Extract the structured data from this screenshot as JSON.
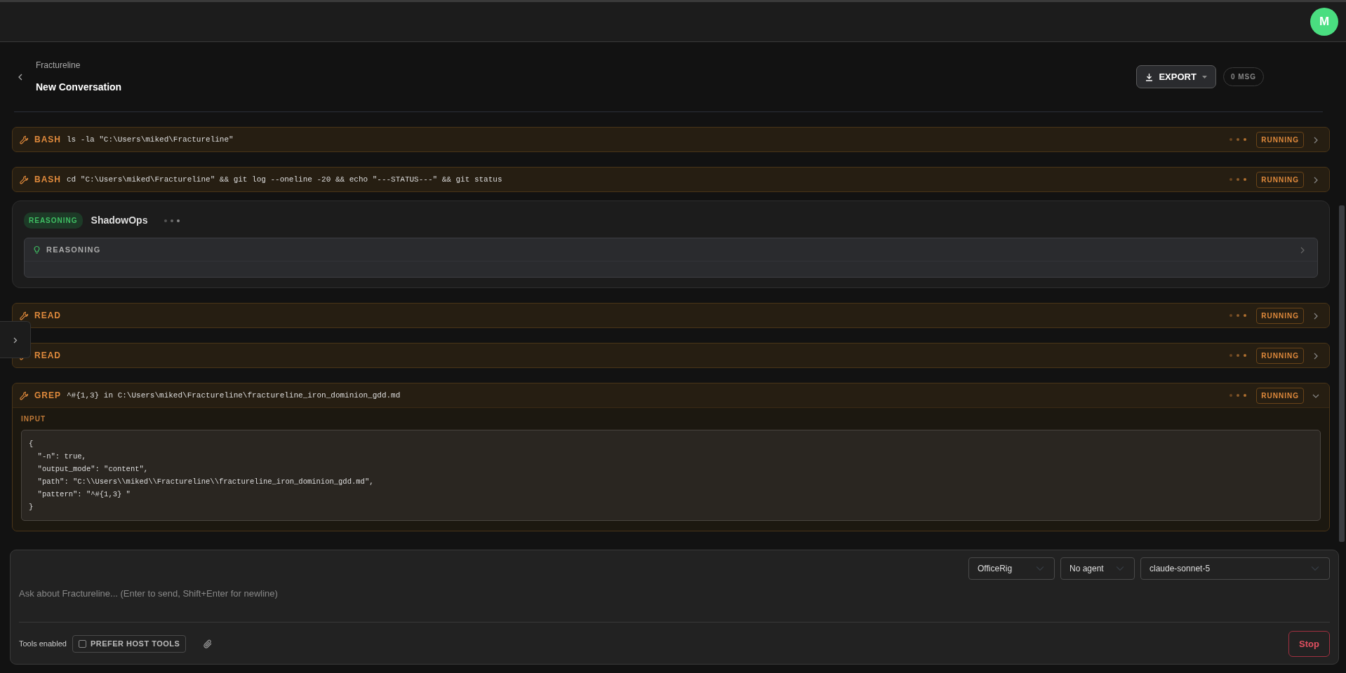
{
  "topbar": {
    "avatar": "M"
  },
  "header": {
    "project": "Fractureline",
    "title": "New Conversation",
    "export_button": "EXPORT",
    "message_count": "0 MSG"
  },
  "messages": [
    {
      "kind": "tool",
      "tool": "BASH",
      "summary": "ls -la \"C:\\Users\\miked\\Fractureline\"",
      "status": "RUNNING",
      "expanded": false
    },
    {
      "kind": "tool",
      "tool": "BASH",
      "summary": "cd \"C:\\Users\\miked\\Fractureline\" && git log --oneline -20 && echo \"---STATUS---\" && git status",
      "status": "RUNNING",
      "expanded": false
    },
    {
      "kind": "reasoning",
      "badge": "REASONING",
      "agent": "ShadowOps",
      "panel_label": "REASONING",
      "expanded": false
    },
    {
      "kind": "tool",
      "tool": "READ",
      "status": "RUNNING",
      "expanded": false
    },
    {
      "kind": "tool",
      "tool": "READ",
      "status": "RUNNING",
      "expanded": false
    },
    {
      "kind": "tool",
      "tool": "GREP",
      "summary": "^#{1,3} in C:\\Users\\miked\\Fractureline\\fractureline_iron_dominion_gdd.md",
      "status": "RUNNING",
      "expanded": true,
      "input_label": "INPUT",
      "input_lines": [
        "{",
        "  \"-n\": true,",
        "  \"output_mode\": \"content\",",
        "  \"path\": \"C:\\\\Users\\\\miked\\\\Fractureline\\\\fractureline_iron_dominion_gdd.md\",",
        "  \"pattern\": \"^#{1,3} \"",
        "}"
      ]
    }
  ],
  "composer": {
    "selects": [
      "OfficeRig",
      "No agent",
      "claude-sonnet-5"
    ],
    "placeholder": "Ask about Fractureline... (Enter to send, Shift+Enter for newline)",
    "tools_label": "Tools enabled",
    "prefer_host_tools": {
      "label": "PREFER HOST TOOLS",
      "checked": false
    },
    "stop_button": "Stop"
  }
}
